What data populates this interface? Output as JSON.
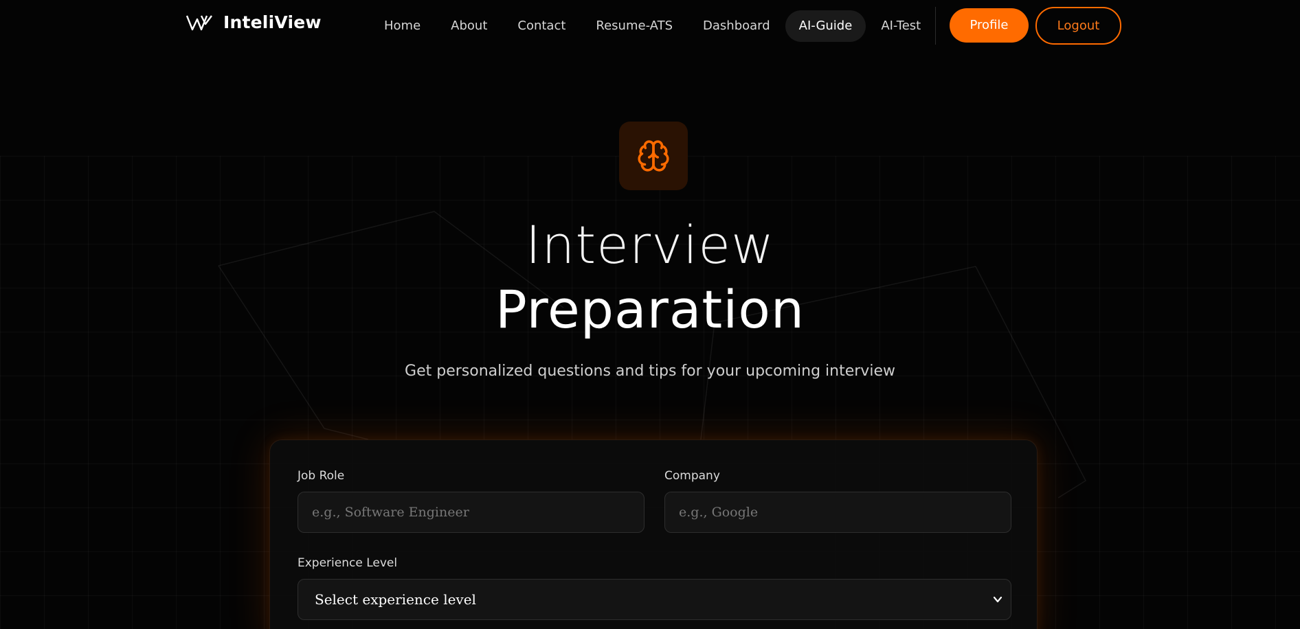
{
  "brand": {
    "name": "InteliView",
    "logo_icon": "wv-logo-icon"
  },
  "nav": {
    "links": [
      {
        "label": "Home"
      },
      {
        "label": "About"
      },
      {
        "label": "Contact"
      },
      {
        "label": "Resume-ATS"
      },
      {
        "label": "Dashboard"
      },
      {
        "label": "AI-Guide",
        "active": true
      },
      {
        "label": "AI-Test"
      }
    ],
    "profile_label": "Profile",
    "logout_label": "Logout"
  },
  "hero": {
    "icon": "brain-icon",
    "title_line1": "Interview",
    "title_line2": "Preparation",
    "subtitle": "Get personalized questions and tips for your upcoming interview"
  },
  "form": {
    "job_role": {
      "label": "Job Role",
      "placeholder": "e.g., Software Engineer",
      "value": ""
    },
    "company": {
      "label": "Company",
      "placeholder": "e.g., Google",
      "value": ""
    },
    "experience": {
      "label": "Experience Level",
      "selected": "Select experience level"
    }
  },
  "colors": {
    "accent": "#ff6b00",
    "background": "#040404",
    "card": "#0c0c0c",
    "input": "#141414"
  }
}
